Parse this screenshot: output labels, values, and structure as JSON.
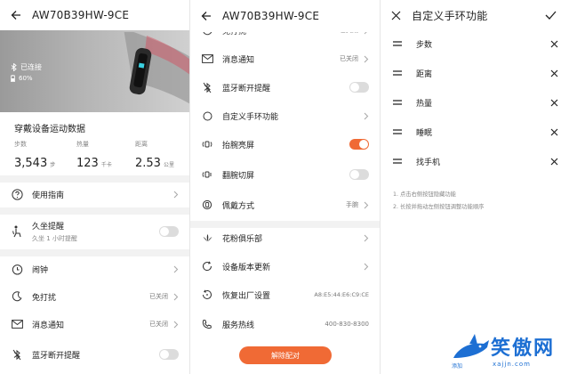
{
  "device_name": "AW70B39HW-9CE",
  "panel1": {
    "status": {
      "connected": "已连接",
      "battery": "60%"
    },
    "section_title": "穿戴设备运动数据",
    "stats": [
      {
        "label": "步数",
        "value": "3,543",
        "unit": "步"
      },
      {
        "label": "热量",
        "value": "123",
        "unit": "千卡"
      },
      {
        "label": "距离",
        "value": "2.53",
        "unit": "公里"
      }
    ],
    "guide": "使用指南",
    "sedentary": {
      "label": "久坐提醒",
      "sub": "久坐 1 小时提醒",
      "on": false
    },
    "alarm": "闹钟",
    "dnd": {
      "label": "免打扰",
      "value": "已关闭"
    },
    "notify": {
      "label": "消息通知",
      "value": "已关闭"
    },
    "bt_remind": {
      "label": "蓝牙断开提醒",
      "on": false
    }
  },
  "panel2": {
    "partial_top": {
      "label": "免打扰",
      "value": "已关闭"
    },
    "notify": {
      "label": "消息通知",
      "value": "已关闭"
    },
    "bt_remind": {
      "label": "蓝牙断开提醒",
      "on": false
    },
    "custom": "自定义手环功能",
    "raise_wrist": {
      "label": "抬腕亮屏",
      "on": true
    },
    "flip_wrist": {
      "label": "翻腕切屏",
      "on": false
    },
    "wear": {
      "label": "佩戴方式",
      "value": "手腕"
    },
    "club": "花粉俱乐部",
    "update": "设备版本更新",
    "reset": {
      "label": "恢复出厂设置",
      "value": "A8:E5:44:E6:C9:CE"
    },
    "hotline": {
      "label": "服务热线",
      "value": "400-830-8300"
    },
    "unpair": "解除配对"
  },
  "panel3": {
    "title": "自定义手环功能",
    "functions": [
      "步数",
      "距离",
      "热量",
      "睡眠",
      "找手机"
    ],
    "notes": [
      "1. 点击右侧按钮隐藏功能",
      "2. 长按并拖动左侧按钮调整功能顺序"
    ]
  },
  "watermark": {
    "name": "笑傲网",
    "url": "xajjn.com",
    "small": "添加"
  },
  "colors": {
    "accent": "#f06a35",
    "watermark": "#1d6fd3"
  },
  "icons": {
    "back": "back-arrow-icon",
    "close": "close-icon",
    "check": "check-icon",
    "drag": "drag-handle-icon",
    "remove": "remove-x-icon"
  }
}
